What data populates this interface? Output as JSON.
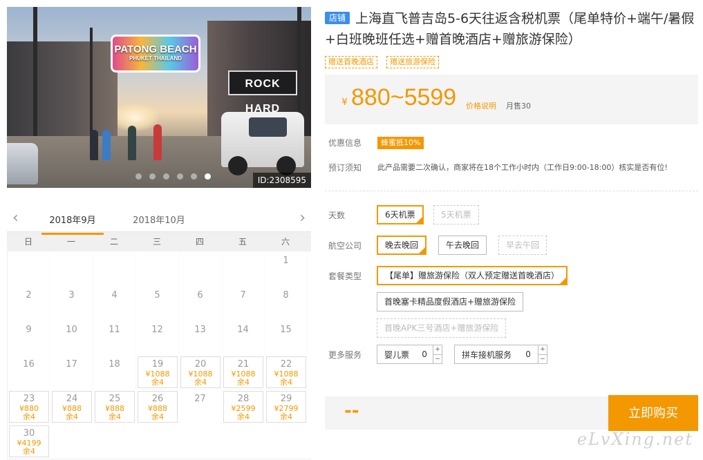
{
  "photo": {
    "arch_line1": "PATONG BEACH",
    "arch_line2": "PHUKET THAILAND",
    "sign": "ROCK HARD",
    "id_label": "ID:2308595",
    "slide_count": 6,
    "active_slide": 6
  },
  "calendar": {
    "prev_icon": "chevron-left-icon",
    "next_icon": "chevron-right-icon",
    "months": [
      "2018年9月",
      "2018年10月"
    ],
    "active_month": 0,
    "weekdays": [
      "日",
      "一",
      "二",
      "三",
      "四",
      "五",
      "六"
    ],
    "leading_blanks": 6,
    "days": [
      {
        "d": "1"
      },
      {
        "d": "2"
      },
      {
        "d": "3"
      },
      {
        "d": "4"
      },
      {
        "d": "5"
      },
      {
        "d": "6"
      },
      {
        "d": "7"
      },
      {
        "d": "8"
      },
      {
        "d": "9"
      },
      {
        "d": "10"
      },
      {
        "d": "11"
      },
      {
        "d": "12"
      },
      {
        "d": "13"
      },
      {
        "d": "14"
      },
      {
        "d": "15"
      },
      {
        "d": "16"
      },
      {
        "d": "17"
      },
      {
        "d": "18"
      },
      {
        "d": "19",
        "price": "¥1088",
        "stock": "余4"
      },
      {
        "d": "20",
        "price": "¥1088",
        "stock": "余4"
      },
      {
        "d": "21",
        "price": "¥1088",
        "stock": "余4"
      },
      {
        "d": "22",
        "price": "¥1088",
        "stock": "余4"
      },
      {
        "d": "23",
        "price": "¥880",
        "stock": "余4"
      },
      {
        "d": "24",
        "price": "¥888",
        "stock": "余4"
      },
      {
        "d": "25",
        "price": "¥888",
        "stock": "余4"
      },
      {
        "d": "26",
        "price": "¥888",
        "stock": "余4"
      },
      {
        "d": "27"
      },
      {
        "d": "28",
        "price": "¥2599",
        "stock": "余4"
      },
      {
        "d": "29",
        "price": "¥2799",
        "stock": "余4"
      },
      {
        "d": "30",
        "price": "¥4199",
        "stock": "余4"
      }
    ]
  },
  "product": {
    "shop_badge": "店铺",
    "title": "上海直飞普吉岛5-6天往返含税机票（尾单特价+端午/暑假+白班晚班任选+赠首晚酒店+赠旅游保险）",
    "tags": [
      "赠送首晚酒店",
      "赠送旅游保险"
    ],
    "currency": "¥",
    "price_range": "880~5599",
    "price_explain": "价格说明",
    "monthly_sales": "月售30",
    "promo_label": "优惠信息",
    "promo_value": "蜂蜜抵10%",
    "notice_label": "预订须知",
    "notice_text": "此产品需要二次确认，商家将在18个工作小时内（工作日9:00-18:00）核实是否有位!"
  },
  "options": {
    "days_label": "天数",
    "days": [
      {
        "label": "6天机票",
        "state": "selected"
      },
      {
        "label": "5天机票",
        "state": "disabled"
      }
    ],
    "airline_label": "航空公司",
    "airline": [
      {
        "label": "晚去晚回",
        "state": "selected"
      },
      {
        "label": "午去晚回",
        "state": "normal"
      },
      {
        "label": "早去午回",
        "state": "disabled"
      }
    ],
    "package_label": "套餐类型",
    "package": [
      {
        "label": "【尾单】赠旅游保险（双人预定赠送首晚酒店）",
        "state": "selected"
      },
      {
        "label": "首晚塞卡精品度假酒店+赠旅游保险",
        "state": "normal"
      },
      {
        "label": "首晚APK三号酒店+赠旅游保险",
        "state": "disabled"
      }
    ],
    "services_label": "更多服务",
    "services": [
      {
        "label": "婴儿票",
        "value": "0"
      },
      {
        "label": "拼车接机服务",
        "value": "0"
      }
    ]
  },
  "buy": {
    "total": "--",
    "button": "立即购买"
  },
  "watermark": "eLvXing.net",
  "colors": {
    "accent": "#f39800",
    "badge": "#3d8ee8"
  }
}
